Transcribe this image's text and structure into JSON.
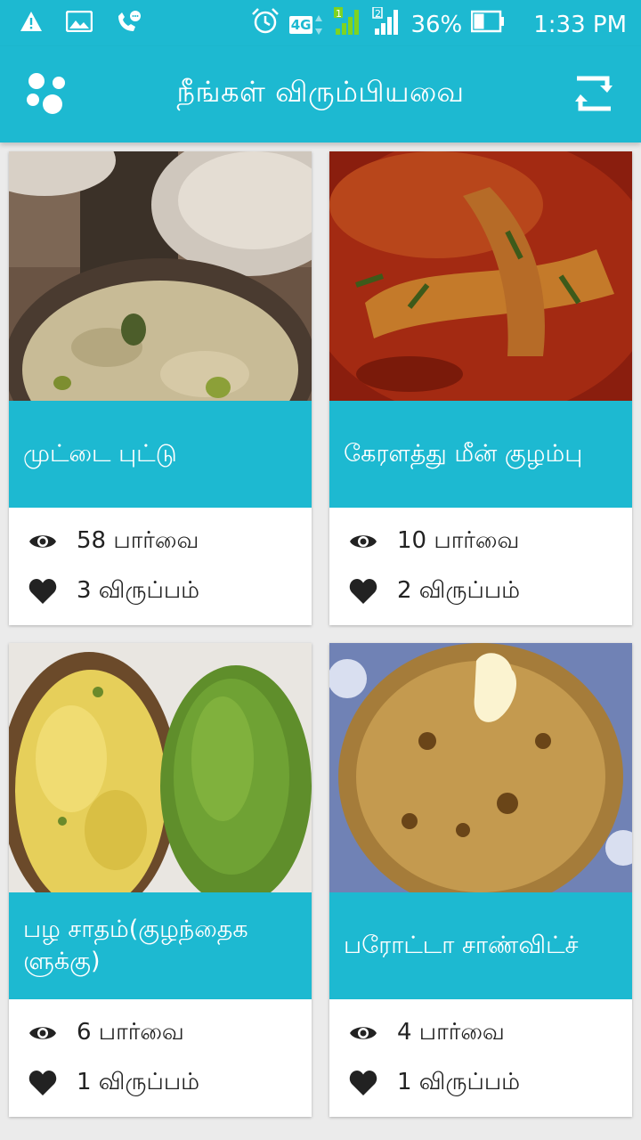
{
  "status_bar": {
    "battery_percent": "36%",
    "time": "1:33 PM",
    "network": "4G",
    "icons": [
      "warning-icon",
      "image-icon",
      "missed-call-icon",
      "alarm-icon",
      "sim1-signal-icon",
      "sim2-signal-icon",
      "battery-icon"
    ]
  },
  "app_bar": {
    "title": "நீங்கள் விரும்பியவை",
    "menu_icon": "dots-menu-icon",
    "action_icon": "refresh-icon"
  },
  "colors": {
    "accent": "#1db9d1",
    "background": "#ebebeb",
    "text": "#222222"
  },
  "recipes": [
    {
      "title": "முட்டை புட்டு",
      "views": "58 பார்வை",
      "likes": "3 விருப்பம்"
    },
    {
      "title": "கேரளத்து மீன் குழம்பு",
      "views": "10 பார்வை",
      "likes": "2 விருப்பம்"
    },
    {
      "title": "பழ சாதம்(குழந்தைக ளுக்கு)",
      "views": "6 பார்வை",
      "likes": "1 விருப்பம்"
    },
    {
      "title": "பரோட்டா சாண்விட்ச்",
      "views": "4 பார்வை",
      "likes": "1 விருப்பம்"
    }
  ]
}
